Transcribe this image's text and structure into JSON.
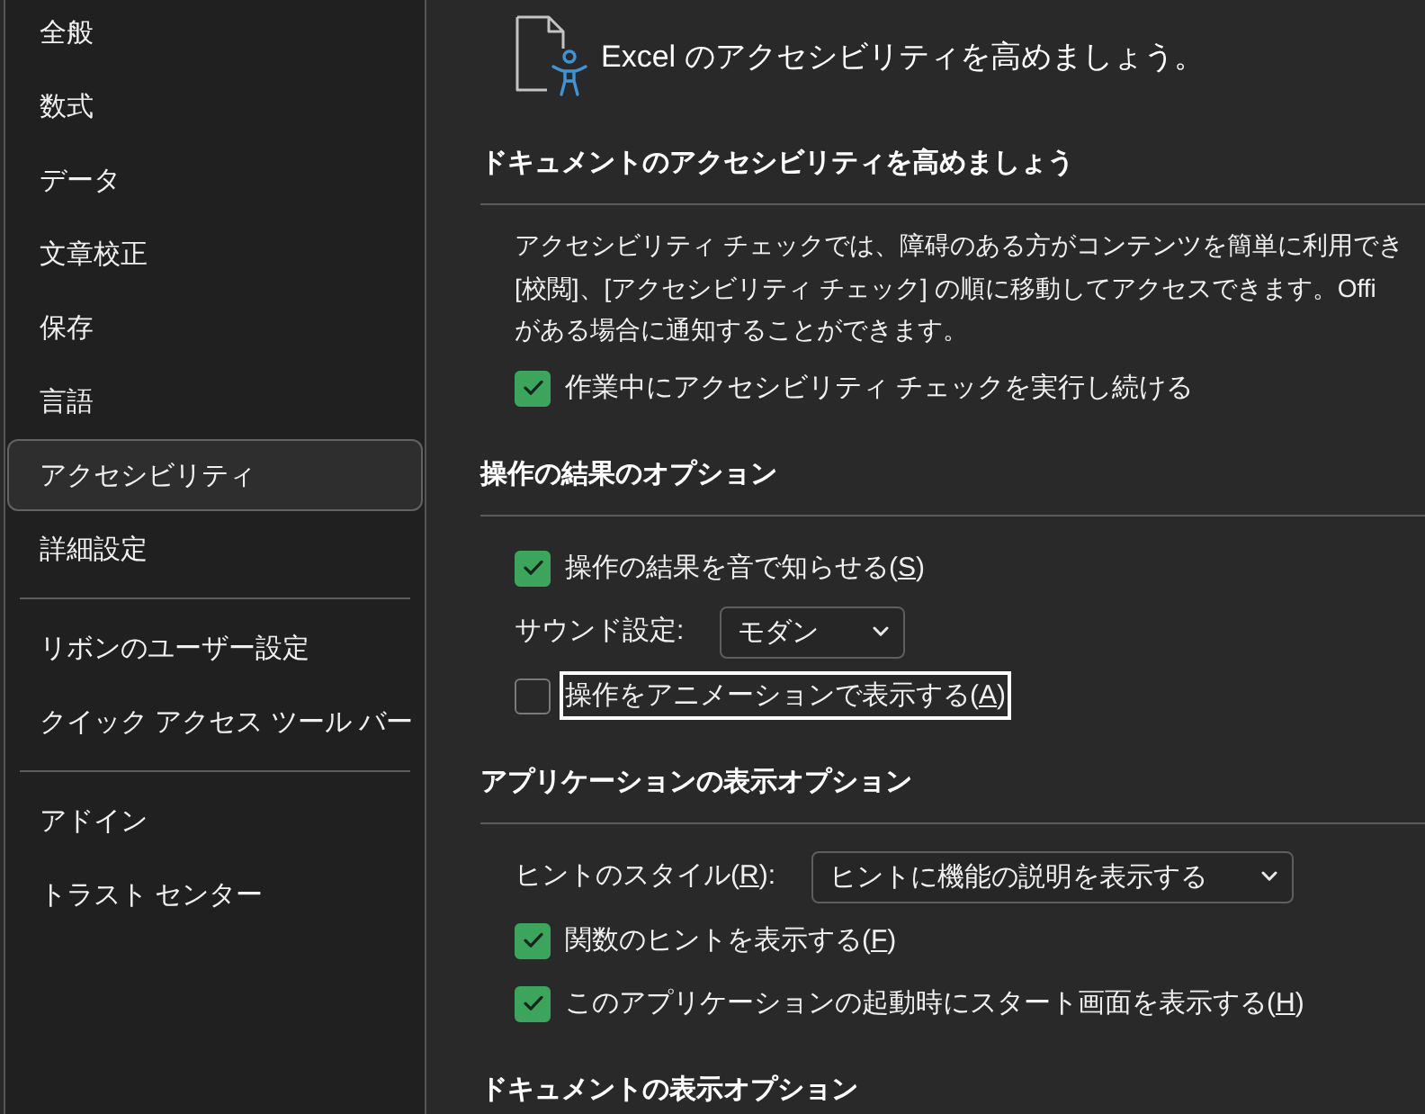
{
  "sidebar": {
    "groups": [
      {
        "items": [
          {
            "label": "全般",
            "selected": false
          },
          {
            "label": "数式",
            "selected": false
          },
          {
            "label": "データ",
            "selected": false
          },
          {
            "label": "文章校正",
            "selected": false
          },
          {
            "label": "保存",
            "selected": false
          },
          {
            "label": "言語",
            "selected": false
          },
          {
            "label": "アクセシビリティ",
            "selected": true
          },
          {
            "label": "詳細設定",
            "selected": false
          }
        ]
      },
      {
        "items": [
          {
            "label": "リボンのユーザー設定",
            "selected": false
          },
          {
            "label": "クイック アクセス ツール バー",
            "selected": false
          }
        ]
      },
      {
        "items": [
          {
            "label": "アドイン",
            "selected": false
          },
          {
            "label": "トラスト センター",
            "selected": false
          }
        ]
      }
    ]
  },
  "header": {
    "title": "Excel のアクセシビリティを高めましょう。"
  },
  "sections": [
    {
      "heading": "ドキュメントのアクセシビリティを高めましょう",
      "rows": [
        {
          "kind": "paragraph",
          "lines": [
            "アクセシビリティ チェックでは、障碍のある方がコンテンツを簡単に利用でき",
            "[校閲]、[アクセシビリティ チェック] の順に移動してアクセスできます。Offi",
            "がある場合に通知することができます。"
          ]
        },
        {
          "kind": "checkbox",
          "label": "作業中にアクセシビリティ チェックを実行し続ける",
          "checked": true,
          "focused": false
        }
      ]
    },
    {
      "heading": "操作の結果のオプション",
      "rows": [
        {
          "kind": "checkbox",
          "label": "操作の結果を音で知らせる(",
          "access_key": "S",
          "label_tail": ")",
          "checked": true,
          "focused": false
        },
        {
          "kind": "dropdown",
          "label": "サウンド設定:",
          "value": "モダン"
        },
        {
          "kind": "checkbox",
          "label": "操作をアニメーションで表示する(",
          "access_key": "A",
          "label_tail": ")",
          "checked": false,
          "focused": true
        }
      ]
    },
    {
      "heading": "アプリケーションの表示オプション",
      "rows": [
        {
          "kind": "dropdown",
          "label": "ヒントのスタイル(",
          "access_key": "R",
          "label_tail": "):",
          "value": "ヒントに機能の説明を表示する"
        },
        {
          "kind": "checkbox",
          "label": "関数のヒントを表示する(",
          "access_key": "F",
          "label_tail": ")",
          "checked": true,
          "focused": false
        },
        {
          "kind": "checkbox",
          "label": "このアプリケーションの起動時にスタート画面を表示する(",
          "access_key": "H",
          "label_tail": ")",
          "checked": true,
          "focused": false
        }
      ]
    },
    {
      "heading": "ドキュメントの表示オプション"
    }
  ]
}
